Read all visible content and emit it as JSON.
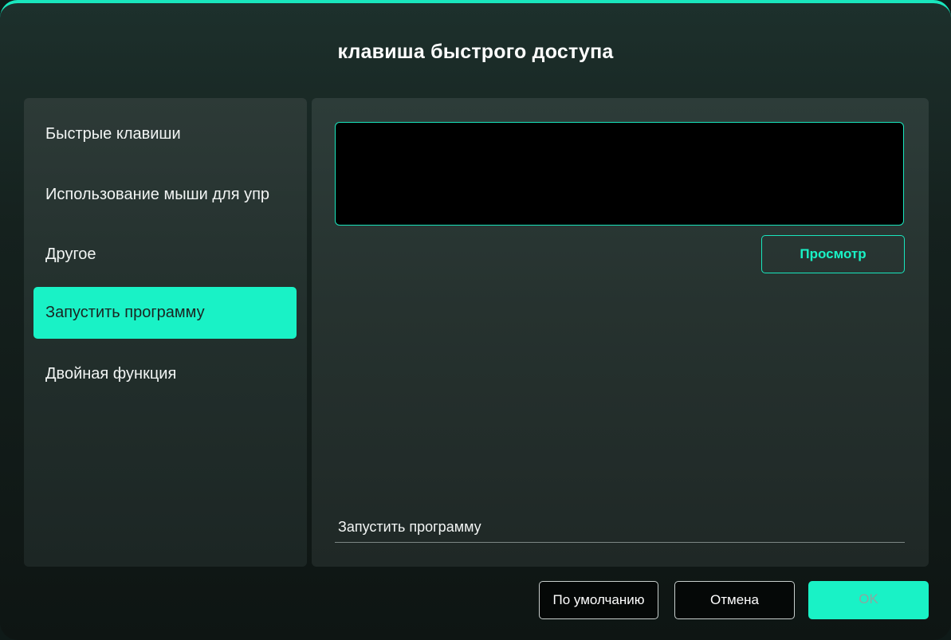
{
  "dialog": {
    "title": "клавиша быстрого доступа"
  },
  "menu": {
    "items": [
      {
        "label": "Быстрые клавиши",
        "active": false
      },
      {
        "label": "Использование мыши для упр",
        "active": false
      },
      {
        "label": "Другое",
        "active": false
      },
      {
        "label": "Запустить программу",
        "active": true
      },
      {
        "label": "Двойная функция",
        "active": false
      }
    ]
  },
  "program": {
    "browse_label": "Просмотр",
    "field_value": "Запустить программу"
  },
  "footer": {
    "default_label": "По умолчанию",
    "cancel_label": "Отмена",
    "ok_label": "OK"
  },
  "colors": {
    "accent": "#19f2c6",
    "border_accent": "#19e6bd",
    "panel": "#26322f",
    "background": "#15211e"
  }
}
